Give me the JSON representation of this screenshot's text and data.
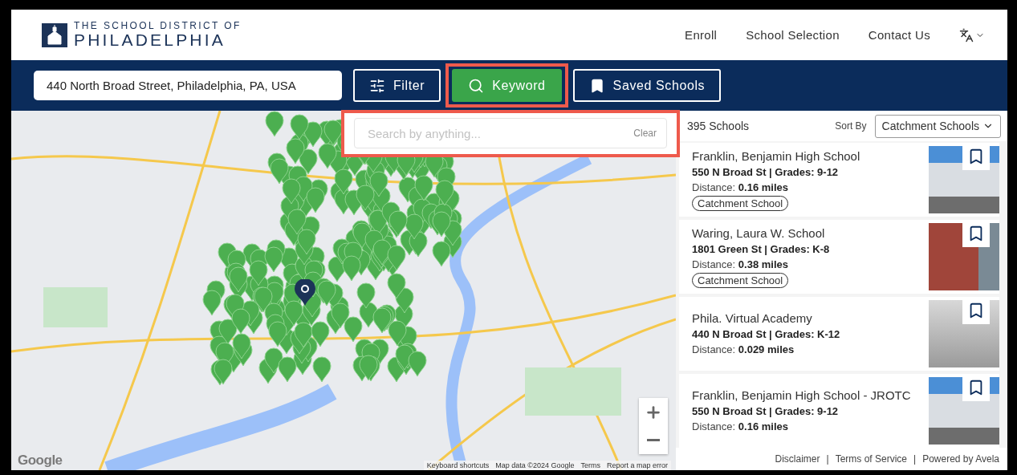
{
  "header": {
    "logo": {
      "line_1": "THE SCHOOL DISTRICT OF",
      "line_2": "PHILADELPHIA"
    },
    "nav": [
      "Enroll",
      "School Selection",
      "Contact Us"
    ]
  },
  "toolbar": {
    "address": "440 North Broad Street, Philadelphia, PA, USA",
    "buttons": [
      {
        "label": "Filter",
        "kind": "filter",
        "selected": false,
        "highlighted": false
      },
      {
        "label": "Keyword",
        "kind": "keyword",
        "selected": true,
        "highlighted": true
      },
      {
        "label": "Saved Schools",
        "kind": "saved",
        "selected": false,
        "highlighted": false
      }
    ]
  },
  "keyword_search": {
    "placeholder": "Search by anything...",
    "clear": "Clear",
    "highlighted": true
  },
  "map": {
    "logo": "Google",
    "attribution": [
      "Keyboard shortcuts",
      "Map data ©2024 Google",
      "Terms",
      "Report a map error"
    ]
  },
  "results": {
    "count": "395 Schools",
    "sort_label": "Sort By",
    "sort_value": "Catchment Schools",
    "schools": [
      {
        "name": "Franklin, Benjamin High School",
        "address": "550 N Broad St | Grades: 9-12",
        "distance": "Distance: **0.16 miles**",
        "badge": "Catchment School",
        "saved": false
      },
      {
        "name": "Waring, Laura W. School",
        "address": "1801 Green St | Grades: K-8",
        "distance": "Distance: **0.38 miles**",
        "badge": "Catchment School",
        "saved": false
      },
      {
        "name": "Phila. Virtual Academy",
        "address": "440 N Broad St | Grades: K-12",
        "distance": "Distance: **0.029 miles**",
        "saved": false
      },
      {
        "name": "Franklin, Benjamin High School - JROTC",
        "address": "550 N Broad St | Grades: 9-12",
        "distance": "Distance: **0.16 miles**",
        "saved": false
      }
    ]
  },
  "footer": {
    "separator": "|",
    "links": [
      "Disclaimer",
      "Terms of Service",
      "Powered by Avela"
    ]
  }
}
